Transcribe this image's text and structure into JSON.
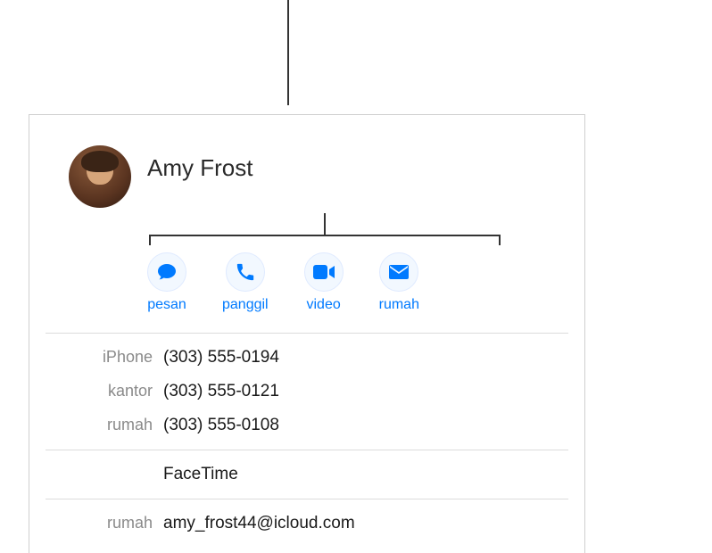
{
  "contact": {
    "name": "Amy Frost"
  },
  "actions": {
    "message": {
      "label": "pesan"
    },
    "call": {
      "label": "panggil"
    },
    "video": {
      "label": "video"
    },
    "mail": {
      "label": "rumah"
    }
  },
  "phones": [
    {
      "label": "iPhone",
      "value": "(303) 555-0194"
    },
    {
      "label": "kantor",
      "value": "(303) 555-0121"
    },
    {
      "label": "rumah",
      "value": "(303) 555-0108"
    }
  ],
  "facetime": {
    "label": "FaceTime"
  },
  "emails": [
    {
      "label": "rumah",
      "value": "amy_frost44@icloud.com"
    }
  ]
}
